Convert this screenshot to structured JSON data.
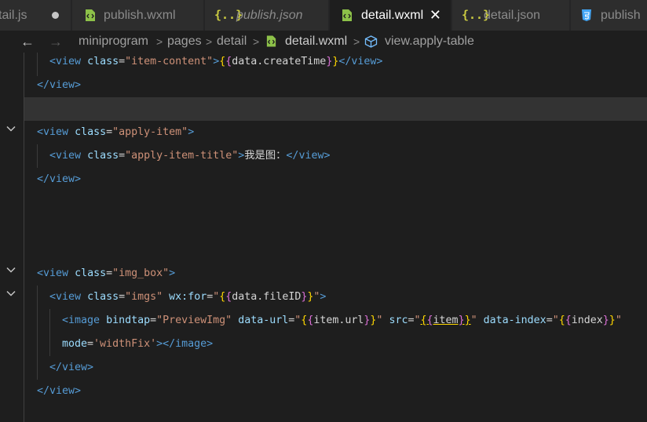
{
  "tabs": [
    {
      "label": "tail.js",
      "icon": "none",
      "active": false,
      "modified": true
    },
    {
      "label": "publish.wxml",
      "icon": "wxml-file-icon",
      "active": false,
      "italic": false
    },
    {
      "label": "publish.json",
      "icon": "json-braces-icon",
      "icon_text": "{..}",
      "active": false,
      "italic": true
    },
    {
      "label": "detail.wxml",
      "icon": "wxml-file-icon",
      "active": true,
      "close": "✕"
    },
    {
      "label": "detail.json",
      "icon": "json-braces-icon",
      "icon_text": "{..}",
      "active": false
    },
    {
      "label": "publish",
      "icon": "css-file-icon",
      "active": false
    }
  ],
  "breadcrumb": {
    "back": "←",
    "forward": "→",
    "items": [
      "miniprogram",
      "pages",
      "detail",
      "detail.wxml",
      "view.apply-table"
    ],
    "separator": ">"
  },
  "code": {
    "l1": {
      "lt": "<",
      "tag": "view",
      "attr": "class",
      "eq": "=",
      "val": "\"item-content\"",
      "gt": ">",
      "ob": "{",
      "ib": "{",
      "expr": "data.createTime",
      "cb": "}",
      "cb2": "}",
      "close": "</",
      "ctag": "view",
      "cgt": ">"
    },
    "l2": {
      "close": "</",
      "ctag": "view",
      "cgt": ">"
    },
    "l3": {
      "lt": "<",
      "tag": "view",
      "attr": "class",
      "eq": "=",
      "val": "\"apply-item\"",
      "gt": ">"
    },
    "l4": {
      "lt": "<",
      "tag": "view",
      "attr": "class",
      "eq": "=",
      "val": "\"apply-item-title\"",
      "gt": ">",
      "text": "我是图：",
      "close": "</",
      "ctag": "view",
      "cgt": ">"
    },
    "l5": {
      "close": "</",
      "ctag": "view",
      "cgt": ">"
    },
    "l6": {
      "lt": "<",
      "tag": "view",
      "attr": "class",
      "eq": "=",
      "val": "\"img_box\"",
      "gt": ">"
    },
    "l7": {
      "lt": "<",
      "tag": "view",
      "attr": "class",
      "eq": "=",
      "val": "\"imgs\"",
      "attr2": "wx:for",
      "eq2": "=",
      "q": "\"",
      "ob": "{",
      "ib": "{",
      "expr": "data.fileID",
      "cb": "}",
      "cb2": "}",
      "q2": "\"",
      "gt": ">"
    },
    "l8": {
      "lt": "<",
      "tag": "image",
      "a1": "bindtap",
      "v1": "\"PreviewImg\"",
      "a2": "data-url",
      "v2q": "\"",
      "ob": "{",
      "ib": "{",
      "e2": "item.url",
      "cb": "}",
      "cb2": "}",
      "v2q2": "\"",
      "a3": "src",
      "v3q": "\"",
      "ob3": "{",
      "ib3": "{",
      "e3": "item",
      "cb3": "}",
      "cb32": "}",
      "v3q2": "\"",
      "a4": "data-index",
      "v4q": "\"",
      "ob4": "{",
      "ib4": "{",
      "e4": "index",
      "cb4": "}",
      "cb42": "}",
      "v4q2": "\""
    },
    "l9": {
      "a": "mode",
      "eq": "=",
      "val": "'widthFix'",
      "gt": ">",
      "close": "</",
      "ctag": "image",
      "cgt": ">"
    },
    "l10": {
      "close": "</",
      "ctag": "view",
      "cgt": ">"
    },
    "l11": {
      "close": "</",
      "ctag": "view",
      "cgt": ">"
    }
  },
  "colors": {
    "tag": "#569cd6",
    "attribute": "#9cdcfe",
    "string": "#ce9178",
    "bracket_gold": "#ffd700",
    "bracket_pink": "#da70d6",
    "current_line": "#333333"
  }
}
